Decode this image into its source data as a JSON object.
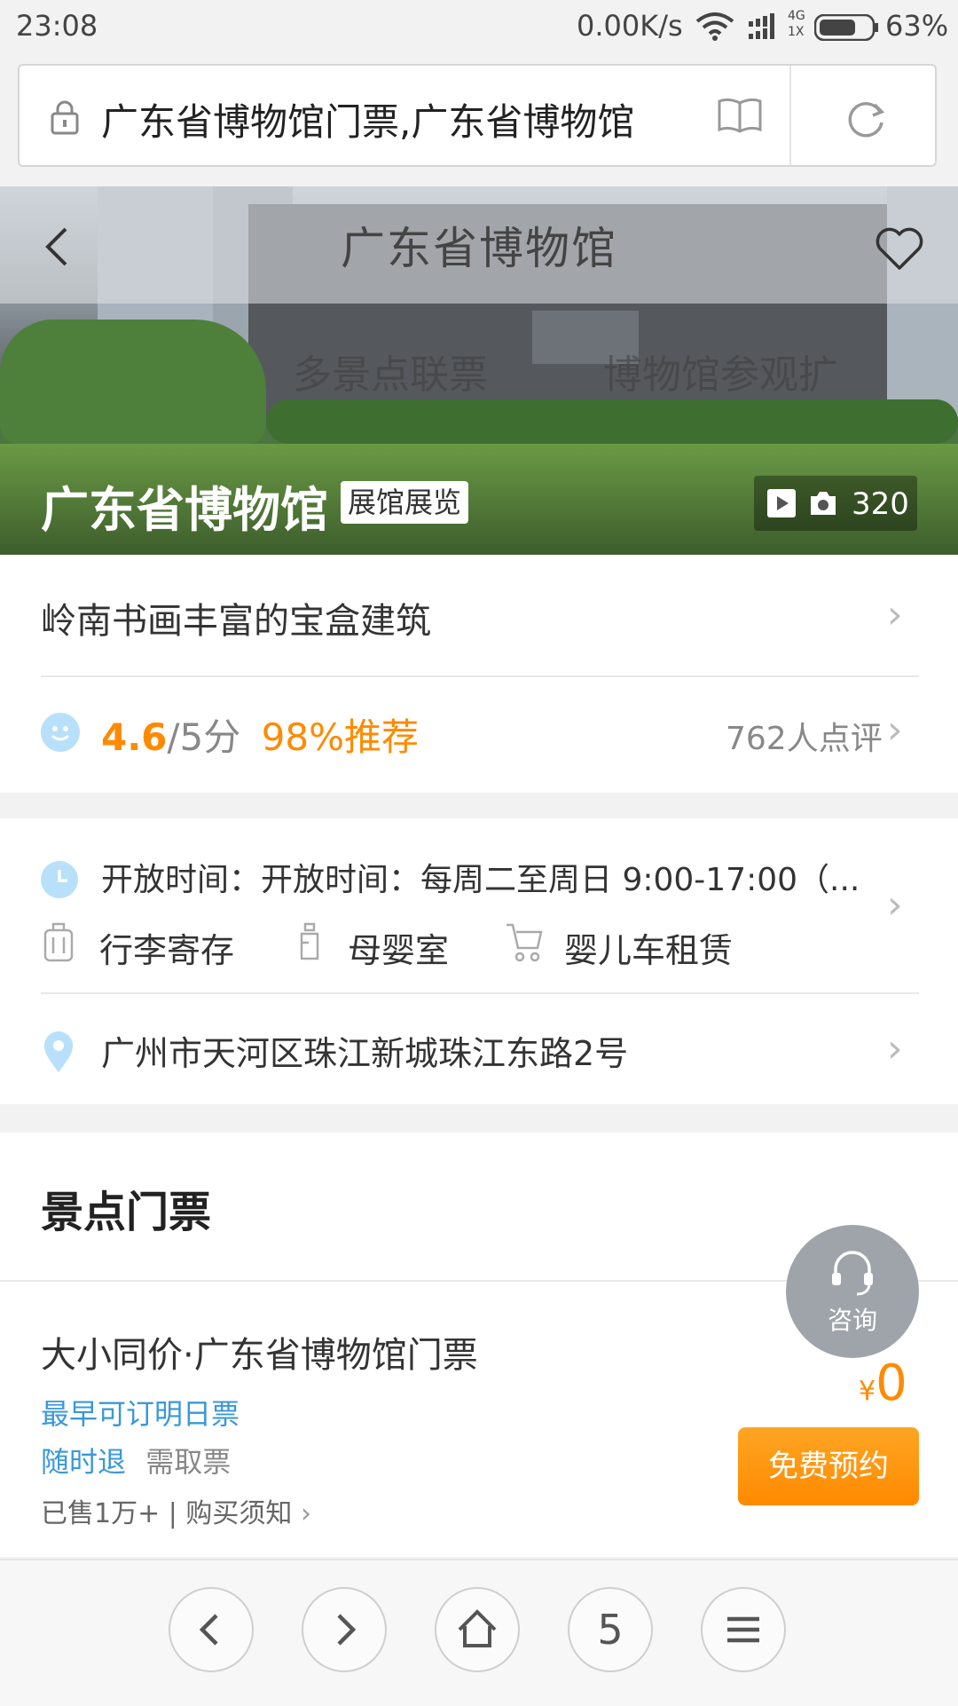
{
  "status_bar": {
    "time": "23:08",
    "net_speed": "0.00K/s",
    "battery": "63%",
    "signal_top": "4G",
    "signal_bottom": "1X"
  },
  "browser": {
    "url_text": "广东省博物馆门票,广东省博物馆"
  },
  "header": {
    "title": "广东省博物馆",
    "tabs": [
      "多景点联票",
      "博物馆参观扩"
    ]
  },
  "hero": {
    "name": "广东省博物馆",
    "tag": "展馆展览",
    "photo_count": "320"
  },
  "summary": {
    "tagline": "岭南书画丰富的宝盒建筑"
  },
  "rating": {
    "score": "4.6",
    "scale": "/5分",
    "recommend": "98%推荐",
    "review_count": "762人点评"
  },
  "info": {
    "hours": "开放时间：开放时间：每周二至周日 9:00-17:00（...",
    "facilities": [
      "行李寄存",
      "母婴室",
      "婴儿车租赁"
    ],
    "address": "广州市天河区珠江新城珠江东路2号"
  },
  "tickets": {
    "section_title": "景点门票",
    "consult_label": "咨询",
    "item": {
      "name": "大小同价·广东省博物馆门票",
      "booking_note": "最早可订明日票",
      "refund": "随时退",
      "pickup": "需取票",
      "sales": "已售1万+ | 购买须知",
      "currency": "¥",
      "price": "0",
      "button": "免费预约"
    }
  },
  "bottom_nav": {
    "tab_count": "5"
  },
  "colors": {
    "accent_orange": "#ff8a00",
    "link_blue": "#3a98d9",
    "icon_blue": "#b8e0fa"
  }
}
